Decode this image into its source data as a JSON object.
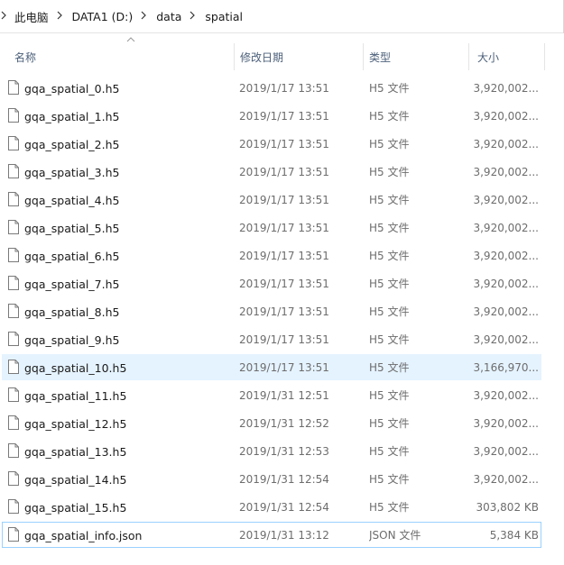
{
  "address": {
    "crumbs": [
      "此电脑",
      "DATA1 (D:)",
      "data",
      "spatial"
    ]
  },
  "columns": {
    "name": "名称",
    "date": "修改日期",
    "type": "类型",
    "size": "大小"
  },
  "files": [
    {
      "name": "gqa_spatial_0.h5",
      "date": "2019/1/17 13:51",
      "type": "H5 文件",
      "size": "3,920,002..."
    },
    {
      "name": "gqa_spatial_1.h5",
      "date": "2019/1/17 13:51",
      "type": "H5 文件",
      "size": "3,920,002..."
    },
    {
      "name": "gqa_spatial_2.h5",
      "date": "2019/1/17 13:51",
      "type": "H5 文件",
      "size": "3,920,002..."
    },
    {
      "name": "gqa_spatial_3.h5",
      "date": "2019/1/17 13:51",
      "type": "H5 文件",
      "size": "3,920,002..."
    },
    {
      "name": "gqa_spatial_4.h5",
      "date": "2019/1/17 13:51",
      "type": "H5 文件",
      "size": "3,920,002..."
    },
    {
      "name": "gqa_spatial_5.h5",
      "date": "2019/1/17 13:51",
      "type": "H5 文件",
      "size": "3,920,002..."
    },
    {
      "name": "gqa_spatial_6.h5",
      "date": "2019/1/17 13:51",
      "type": "H5 文件",
      "size": "3,920,002..."
    },
    {
      "name": "gqa_spatial_7.h5",
      "date": "2019/1/17 13:51",
      "type": "H5 文件",
      "size": "3,920,002..."
    },
    {
      "name": "gqa_spatial_8.h5",
      "date": "2019/1/17 13:51",
      "type": "H5 文件",
      "size": "3,920,002..."
    },
    {
      "name": "gqa_spatial_9.h5",
      "date": "2019/1/17 13:51",
      "type": "H5 文件",
      "size": "3,920,002..."
    },
    {
      "name": "gqa_spatial_10.h5",
      "date": "2019/1/17 13:51",
      "type": "H5 文件",
      "size": "3,166,970..."
    },
    {
      "name": "gqa_spatial_11.h5",
      "date": "2019/1/31 12:51",
      "type": "H5 文件",
      "size": "3,920,002..."
    },
    {
      "name": "gqa_spatial_12.h5",
      "date": "2019/1/31 12:52",
      "type": "H5 文件",
      "size": "3,920,002..."
    },
    {
      "name": "gqa_spatial_13.h5",
      "date": "2019/1/31 12:53",
      "type": "H5 文件",
      "size": "3,920,002..."
    },
    {
      "name": "gqa_spatial_14.h5",
      "date": "2019/1/31 12:54",
      "type": "H5 文件",
      "size": "3,920,002..."
    },
    {
      "name": "gqa_spatial_15.h5",
      "date": "2019/1/31 12:54",
      "type": "H5 文件",
      "size": "303,802 KB"
    },
    {
      "name": "gqa_spatial_info.json",
      "date": "2019/1/31 13:12",
      "type": "JSON 文件",
      "size": "5,384 KB"
    }
  ],
  "selection": {
    "hovered_index": 10,
    "focused_index": 16
  },
  "colors": {
    "header_text": "#4c607a",
    "hover_bg": "#e5f3ff",
    "focus_border": "#99d1ff",
    "meta_text": "#6d6d6d"
  },
  "icons": {
    "file": "document-icon",
    "sort": "sort-ascending-icon",
    "separator": "chevron-right-icon"
  }
}
